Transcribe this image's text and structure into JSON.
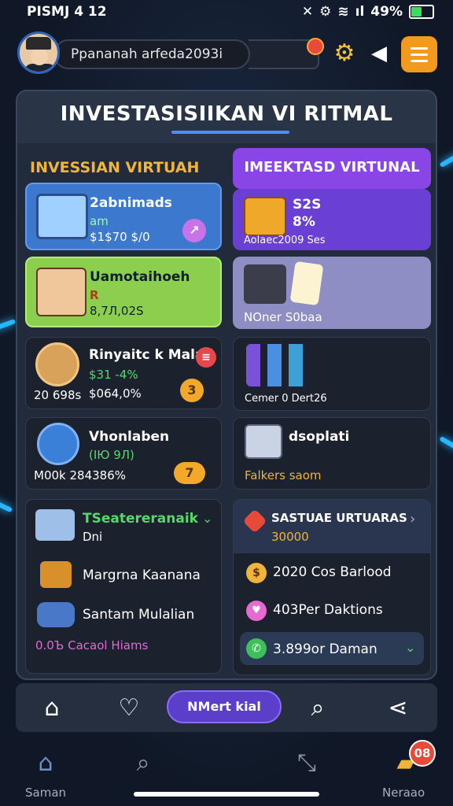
{
  "status_bar": {
    "time": "PISMJ 4 12",
    "battery": "49%"
  },
  "header": {
    "search_text": "Ppananah arfeda2093i"
  },
  "title": "INVESTASISIIKAN VI RITMAL",
  "left_column": {
    "heading": "INVESSIAN VIRTUAH",
    "cards": [
      {
        "title": "2abnimads",
        "line2": "am",
        "line3": "$1$70 $/0"
      },
      {
        "title": "Uamotaihoeh",
        "line2": "R",
        "line3": "8,7Л,02S"
      },
      {
        "title": "Rinyaitc k Malali",
        "line2": "$31 -4%",
        "line3": "20 698s",
        "line4": "$064,0%",
        "badge": "3"
      },
      {
        "title": "Vhonlaben",
        "line2": "(IЮ 9Л)",
        "line3": "M00k 284386%",
        "badge": "7"
      }
    ],
    "list": {
      "title": "TSeatereranaik",
      "subtitle": "Dni",
      "items": [
        "Margrna Kaanana",
        "Santam Mulalian"
      ],
      "footer": "0.0Ъ Cacaol Hiams"
    }
  },
  "right_column": {
    "heading": "IMEEKTASD VIRTUNAL",
    "cards": [
      {
        "title": "S2S",
        "line2": "8%",
        "line3": "Aolaec2009 Ses"
      },
      {
        "title": "NOner S0baa"
      },
      {
        "title": "Cemer 0 Dert26"
      },
      {
        "title": "dsoplati",
        "line2": "Falkers saom"
      }
    ],
    "list": {
      "title": "SASTUAE URTUARAS",
      "value": "30000",
      "items": [
        "2020 Cos Barlood",
        "403Per Daktions",
        "3.899or Daman"
      ]
    }
  },
  "bottom_bar": {
    "center_label": "NMert kial"
  },
  "bottom_nav": {
    "left_label": "Saman",
    "right_label": "Neraao",
    "right_badge": "08"
  },
  "colors": {
    "accent_purple": "#5b3ec9",
    "accent_orange": "#f19a1e",
    "card_blue": "#3a73c8",
    "card_green": "#8bd44a"
  }
}
